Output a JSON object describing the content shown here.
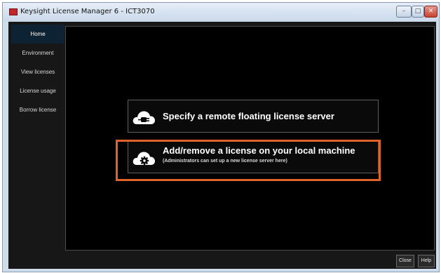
{
  "window": {
    "title": "Keysight License Manager 6 - ICT3070",
    "controls": {
      "minimize": "–",
      "maximize": "□",
      "close": "✕"
    }
  },
  "sidebar": {
    "items": [
      {
        "label": "Home",
        "active": true
      },
      {
        "label": "Environment",
        "active": false
      },
      {
        "label": "View licenses",
        "active": false
      },
      {
        "label": "License usage",
        "active": false
      },
      {
        "label": "Borrow license",
        "active": false
      }
    ]
  },
  "options": {
    "remote": {
      "title": "Specify a remote floating license server",
      "icon": "cloud-plug-icon"
    },
    "local": {
      "title": "Add/remove a license on your local machine",
      "subtitle": "(Administrators can set up a new license server here)",
      "icon": "cloud-gear-icon"
    }
  },
  "footer": {
    "close_label": "Close",
    "help_label": "Help"
  },
  "colors": {
    "highlight": "#e0642a",
    "active_nav": "#0d2232",
    "background": "#000000"
  }
}
